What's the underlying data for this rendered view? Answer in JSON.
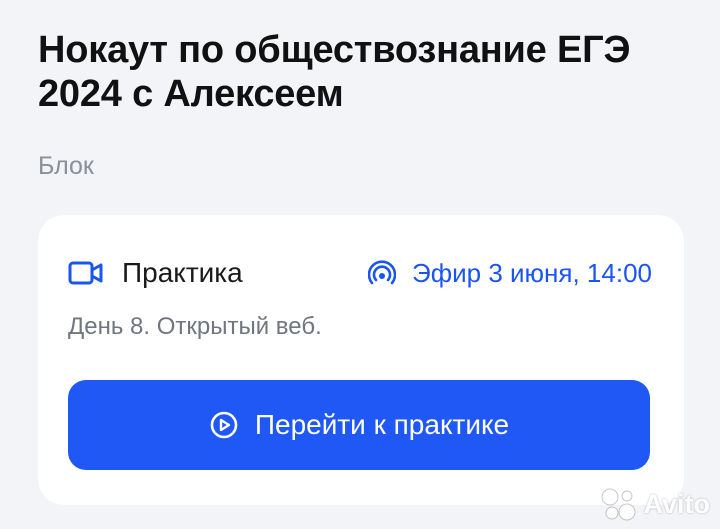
{
  "header": {
    "title": "Нокаут по обществознание ЕГЭ 2024 с Алексеем",
    "section": "Блок"
  },
  "card": {
    "lesson_type": "Практика",
    "lesson_icon": "video-camera-icon",
    "broadcast_icon": "broadcast-icon",
    "broadcast": "Эфир 3 июня, 14:00",
    "description": "День 8. Открытый веб.",
    "button_label": "Перейти к практике",
    "button_icon": "play-circle-icon"
  },
  "watermark": {
    "text": "Avito"
  },
  "colors": {
    "background": "#f2f4f8",
    "card": "#ffffff",
    "accent": "#1f58f5",
    "accent_text": "#1a55f0",
    "muted_text": "#8a8f98"
  }
}
